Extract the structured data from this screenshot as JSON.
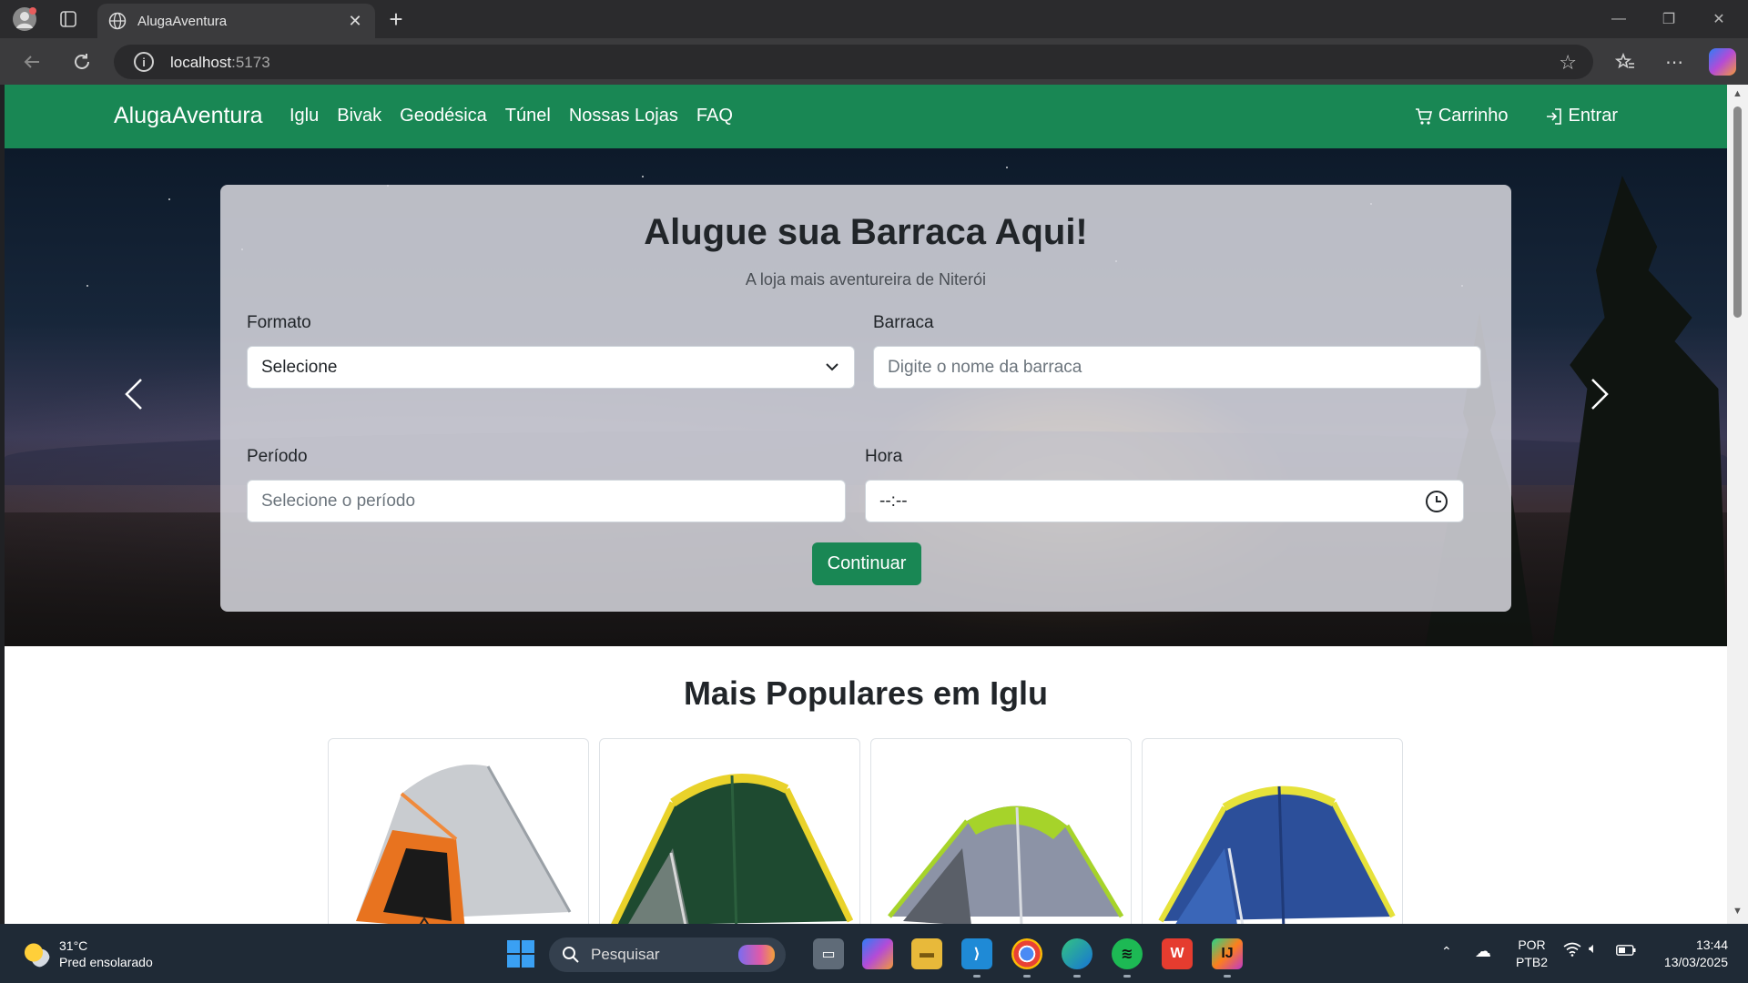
{
  "browser": {
    "tab_title": "AlugaAventura",
    "url_host": "localhost",
    "url_port": ":5173"
  },
  "navbar": {
    "brand": "AlugaAventura",
    "links": [
      "Iglu",
      "Bivak",
      "Geodésica",
      "Túnel",
      "Nossas Lojas",
      "FAQ"
    ],
    "cart_label": "Carrinho",
    "login_label": "Entrar"
  },
  "hero": {
    "title": "Alugue sua Barraca Aqui!",
    "subtitle": "A loja mais aventureira de Niterói",
    "formato_label": "Formato",
    "formato_value": "Selecione",
    "barraca_label": "Barraca",
    "barraca_placeholder": "Digite o nome da barraca",
    "periodo_label": "Período",
    "periodo_placeholder": "Selecione o período",
    "hora_label": "Hora",
    "hora_value": "--:--",
    "continue_label": "Continuar"
  },
  "popular": {
    "title": "Mais Populares em Iglu",
    "products": [
      {
        "colors": [
          "#c9ccd0",
          "#e8731f"
        ]
      },
      {
        "colors": [
          "#1e4a30",
          "#e9d22a"
        ]
      },
      {
        "colors": [
          "#8c93a6",
          "#a6d32a"
        ]
      },
      {
        "colors": [
          "#2c4f9a",
          "#e6e23a"
        ]
      }
    ]
  },
  "taskbar": {
    "weather_temp": "31°C",
    "weather_desc": "Pred ensolarado",
    "search_label": "Pesquisar",
    "lang_top": "POR",
    "lang_bottom": "PTB2",
    "time": "13:44",
    "date": "13/03/2025"
  },
  "colors": {
    "brand_green": "#198754",
    "browser_dark": "#2b2b2d"
  }
}
